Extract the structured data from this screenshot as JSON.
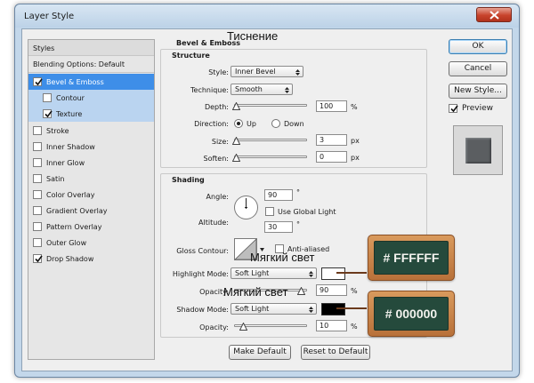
{
  "window": {
    "title": "Layer Style"
  },
  "styles_list": {
    "header": "Styles",
    "blending": "Blending Options: Default",
    "items": [
      {
        "label": "Bevel & Emboss",
        "checked": true
      },
      {
        "label": "Contour",
        "checked": false
      },
      {
        "label": "Texture",
        "checked": true
      },
      {
        "label": "Stroke",
        "checked": false
      },
      {
        "label": "Inner Shadow",
        "checked": false
      },
      {
        "label": "Inner Glow",
        "checked": false
      },
      {
        "label": "Satin",
        "checked": false
      },
      {
        "label": "Color Overlay",
        "checked": false
      },
      {
        "label": "Gradient Overlay",
        "checked": false
      },
      {
        "label": "Pattern Overlay",
        "checked": false
      },
      {
        "label": "Outer Glow",
        "checked": false
      },
      {
        "label": "Drop Shadow",
        "checked": true
      }
    ]
  },
  "buttons": {
    "ok": "OK",
    "cancel": "Cancel",
    "new_style": "New Style...",
    "preview": "Preview",
    "make_default": "Make Default",
    "reset_default": "Reset to Default"
  },
  "bevel": {
    "title": "Bevel & Emboss",
    "structure": {
      "label": "Structure",
      "style_label": "Style:",
      "style_value": "Inner Bevel",
      "technique_label": "Technique:",
      "technique_value": "Smooth",
      "depth_label": "Depth:",
      "depth_value": "100",
      "depth_unit": "%",
      "direction_label": "Direction:",
      "direction_up": "Up",
      "direction_down": "Down",
      "size_label": "Size:",
      "size_value": "3",
      "size_unit": "px",
      "soften_label": "Soften:",
      "soften_value": "0",
      "soften_unit": "px"
    },
    "shading": {
      "label": "Shading",
      "angle_label": "Angle:",
      "angle_value": "90",
      "angle_unit": "°",
      "global_light": "Use Global Light",
      "altitude_label": "Altitude:",
      "altitude_value": "30",
      "altitude_unit": "°",
      "gloss_label": "Gloss Contour:",
      "anti_aliased": "Anti-aliased",
      "highlight_label": "Highlight Mode:",
      "highlight_mode": "Soft Light",
      "highlight_color": "#ffffff",
      "highlight_opacity_label": "Opacity:",
      "highlight_opacity": "90",
      "shadow_label": "Shadow Mode:",
      "shadow_mode": "Soft Light",
      "shadow_color": "#000000",
      "shadow_opacity_label": "Opacity:",
      "shadow_opacity": "10",
      "percent": "%"
    }
  },
  "annotations": {
    "emboss": "Тиснение",
    "soft_light_1": "Мягкий свет",
    "soft_light_2": "Мягкий свет",
    "badge_white": "# FFFFFF",
    "badge_black": "# 000000"
  }
}
